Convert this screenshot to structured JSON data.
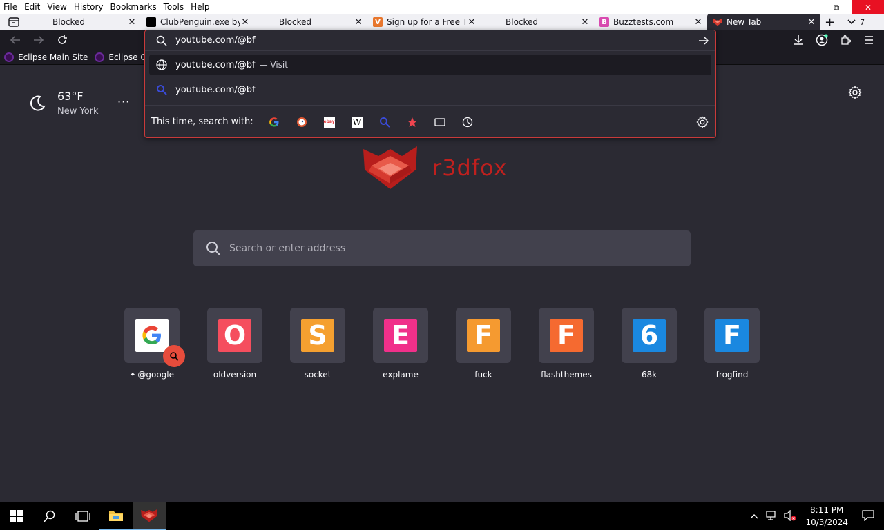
{
  "menubar": {
    "items": [
      "File",
      "Edit",
      "View",
      "History",
      "Bookmarks",
      "Tools",
      "Help"
    ]
  },
  "window_controls": {
    "minimize": "—",
    "restore": "⧉",
    "close": "✕"
  },
  "tabs": [
    {
      "title": "Blocked",
      "favicon": "none"
    },
    {
      "title": "ClubPenguin.exe by",
      "favicon": "black-square-icon"
    },
    {
      "title": "Blocked",
      "favicon": "none"
    },
    {
      "title": "Sign up for a Free Tr",
      "favicon": "orange-v-icon"
    },
    {
      "title": "Blocked",
      "favicon": "none"
    },
    {
      "title": "Buzztests.com",
      "favicon": "pink-b-icon"
    },
    {
      "title": "New Tab",
      "favicon": "r3dfox-icon",
      "active": true
    }
  ],
  "tab_count": "7",
  "bookmarks": [
    {
      "label": "Eclipse Main Site"
    },
    {
      "label": "Eclipse Com"
    }
  ],
  "urlbar": {
    "value": "youtube.com/@bf",
    "results": [
      {
        "text": "youtube.com/@bf",
        "action": "— Visit",
        "icon": "globe-icon",
        "selected": true
      },
      {
        "text": "youtube.com/@bf",
        "action": "",
        "icon": "search-icon",
        "selected": false
      }
    ],
    "oneoff_label": "This time, search with:",
    "oneoff_engines": [
      "google-icon",
      "duckduckgo-icon",
      "ebay-icon",
      "wikipedia-icon",
      "search-icon",
      "bookmarks-star-icon",
      "tabs-icon",
      "history-clock-icon"
    ]
  },
  "weather": {
    "temp": "63°F",
    "city": "New York",
    "icon": "moon-icon",
    "more": "···"
  },
  "logo": {
    "text": "r3dfox"
  },
  "search": {
    "placeholder": "Search or enter address"
  },
  "tiles": [
    {
      "label": "@google",
      "letter": "G",
      "color": "#ffffff",
      "fg": "#4285f4",
      "pinned": true
    },
    {
      "label": "oldversion",
      "letter": "O",
      "color": "#f54e5e",
      "fg": "#ffffff"
    },
    {
      "label": "socket",
      "letter": "S",
      "color": "#f5a030",
      "fg": "#ffffff"
    },
    {
      "label": "explame",
      "letter": "E",
      "color": "#f0308a",
      "fg": "#ffffff"
    },
    {
      "label": "fuck",
      "letter": "F",
      "color": "#f59a30",
      "fg": "#ffffff"
    },
    {
      "label": "flashthemes",
      "letter": "F",
      "color": "#f56a30",
      "fg": "#ffffff"
    },
    {
      "label": "68k",
      "letter": "6",
      "color": "#1a88e0",
      "fg": "#ffffff"
    },
    {
      "label": "frogfind",
      "letter": "F",
      "color": "#1a88e0",
      "fg": "#ffffff"
    }
  ],
  "taskbar": {
    "time": "8:11 PM",
    "date": "10/3/2024"
  },
  "colors": {
    "accent": "#c0201e",
    "bg": "#2b2a33",
    "toolbar": "#1c1b22"
  }
}
